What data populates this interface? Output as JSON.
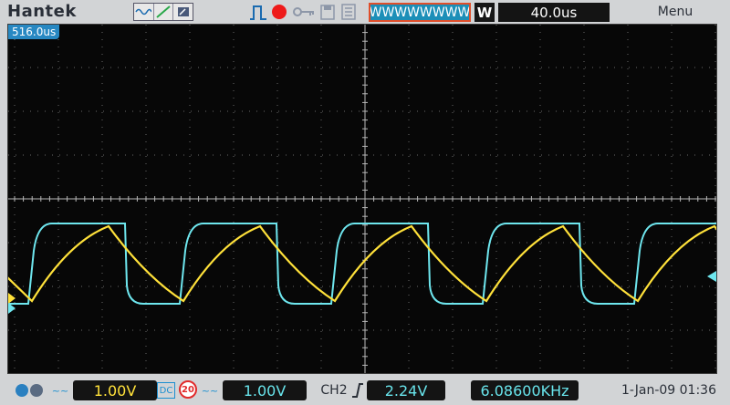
{
  "header": {
    "brand": "Hantek",
    "waveform_label": "WWWWWWWW",
    "mode": "W",
    "timebase": "40.0us",
    "menu": "Menu"
  },
  "screen": {
    "trigger_time": "516.0us"
  },
  "footer": {
    "ch1_coupling": "~~",
    "ch1_volts": "1.00V",
    "ch2_coupling": "DC",
    "bw_limit": "20",
    "ch2_probe": "~~",
    "ch2_volts": "1.00V",
    "trigger_source": "CH2",
    "trigger_level": "2.24V",
    "frequency": "6.08600KHz",
    "datetime": "1-Jan-09 01:36"
  },
  "colors": {
    "ch1": "#ffe13a",
    "ch2": "#6ee6ee",
    "accent": "#1c8fb8",
    "record": "#ee1a1a"
  },
  "icons": [
    "hantek-logo",
    "waveform-icon",
    "ramp-icon",
    "cursor-icon",
    "run-stop-icon",
    "record-icon",
    "key-icon",
    "save-icon",
    "usb-icon",
    "menu-icon"
  ]
}
